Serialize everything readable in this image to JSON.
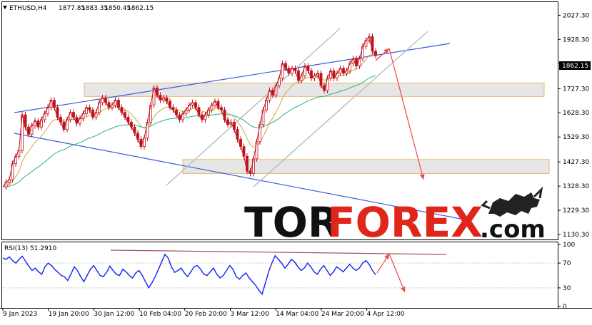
{
  "header": {
    "symbol": "ETHUSD,H4",
    "open": "1877.85",
    "high": "1883.35",
    "low": "1850.45",
    "close": "1862.15"
  },
  "last_price_tag": "1862.15",
  "rsi_label": "RSI(13) 51.2910",
  "logo": {
    "part1": "TOR",
    "part2": "FOREX",
    "part3": ".com"
  },
  "colors": {
    "candle": "#c0111b",
    "ma_fast": "#d4a640",
    "ma_slow": "#2db08a",
    "trend_blue": "#3b5bdb",
    "channel_gray": "#b9bec6",
    "zone_fill": "#e6e6e6",
    "zone_border": "#e8b66b",
    "arrow_red": "#ef4444",
    "rsi_line": "#1f2ef0",
    "rsi_resistance": "#9c5a5a"
  },
  "chart_data": [
    {
      "type": "line",
      "title": "ETHUSD,H4",
      "y_ticks": [
        "2027.30",
        "1928.30",
        "1829.30",
        "1727.30",
        "1628.30",
        "1529.30",
        "1427.30",
        "1328.30",
        "1229.30",
        "1130.30"
      ],
      "ylim": [
        1110,
        2075
      ],
      "x_ticks": [
        "9 Jan 2023",
        "19 Jan 20:00",
        "30 Jan 12:00",
        "10 Feb 04:00",
        "20 Feb 20:00",
        "3 Mar 12:00",
        "14 Mar 04:00",
        "24 Mar 20:00",
        "4 Apr 12:00"
      ],
      "series": [
        {
          "values": [
            1325,
            1345,
            1355,
            1420,
            1450,
            1475,
            1620,
            1570,
            1540,
            1575,
            1595,
            1570,
            1600,
            1625,
            1650,
            1680,
            1650,
            1610,
            1590,
            1560,
            1600,
            1630,
            1610,
            1585,
            1605,
            1625,
            1650,
            1640,
            1610,
            1630,
            1670,
            1690,
            1670,
            1650,
            1660,
            1680,
            1650,
            1630,
            1610,
            1590,
            1570,
            1545,
            1520,
            1490,
            1525,
            1590,
            1660,
            1730,
            1700,
            1680,
            1690,
            1675,
            1650,
            1640,
            1620,
            1600,
            1625,
            1640,
            1660,
            1670,
            1650,
            1620,
            1600,
            1620,
            1640,
            1660,
            1675,
            1650,
            1640,
            1600,
            1580,
            1590,
            1560,
            1520,
            1490,
            1450,
            1390,
            1380,
            1440,
            1510,
            1580,
            1640,
            1680,
            1720,
            1700,
            1740,
            1770,
            1830,
            1810,
            1790,
            1810,
            1800,
            1760,
            1780,
            1820,
            1800,
            1770,
            1780,
            1790,
            1740,
            1720,
            1770,
            1800,
            1770,
            1790,
            1810,
            1790,
            1800,
            1830,
            1850,
            1820,
            1850,
            1900,
            1925,
            1940,
            1880,
            1862.15
          ]
        }
      ],
      "annotations": {
        "upper_trendline": "blue",
        "lower_trendline": "blue",
        "ascending_channel": "gray",
        "resistance_zone": [
          1695,
          1750
        ],
        "support_zone": [
          1380,
          1437
        ],
        "forecast": "down"
      }
    },
    {
      "type": "line",
      "title": "RSI(13) 51.2910",
      "y_ticks": [
        "100",
        "70",
        "30",
        "0"
      ],
      "ylim": [
        0,
        100
      ],
      "series": [
        {
          "values": [
            78,
            76,
            80,
            74,
            70,
            76,
            81,
            73,
            65,
            58,
            62,
            56,
            52,
            64,
            70,
            66,
            60,
            55,
            50,
            48,
            42,
            52,
            64,
            58,
            48,
            40,
            50,
            60,
            66,
            58,
            50,
            48,
            55,
            65,
            58,
            52,
            50,
            60,
            56,
            50,
            46,
            54,
            58,
            50,
            40,
            30,
            38,
            48,
            60,
            72,
            84,
            78,
            64,
            55,
            58,
            62,
            54,
            48,
            56,
            64,
            66,
            60,
            52,
            50,
            56,
            62,
            52,
            46,
            50,
            58,
            66,
            60,
            48,
            44,
            50,
            54,
            46,
            40,
            34,
            26,
            20,
            38,
            56,
            70,
            82,
            76,
            70,
            62,
            68,
            76,
            72,
            64,
            58,
            62,
            70,
            64,
            56,
            52,
            60,
            66,
            58,
            50,
            56,
            64,
            60,
            56,
            62,
            68,
            62,
            58,
            62,
            70,
            74,
            68,
            58,
            51.29
          ]
        }
      ],
      "annotations": {
        "resistance_line": "descending",
        "forecast": "down"
      }
    }
  ]
}
